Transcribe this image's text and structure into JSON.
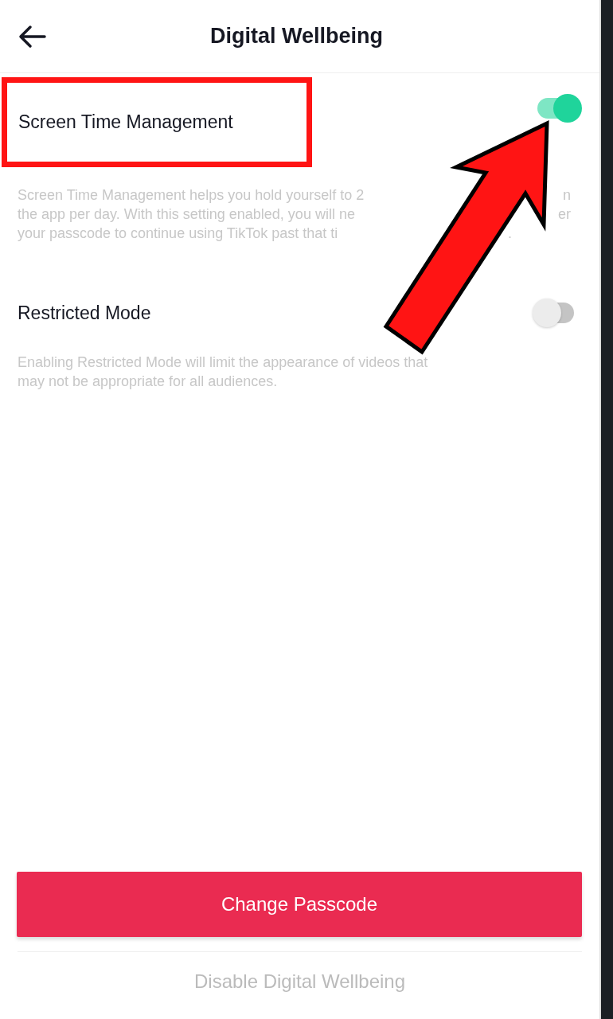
{
  "header": {
    "title": "Digital Wellbeing"
  },
  "settings": [
    {
      "label": "Screen Time Management",
      "on": true,
      "highlighted": true,
      "description_lines": [
        {
          "left": "Screen Time Management helps you hold yourself to 2",
          "right": "n"
        },
        {
          "left": "the app per day. With this setting enabled, you will ne",
          "right": "er"
        },
        {
          "left": "your passcode to continue using TikTok past that ti",
          "right": "."
        }
      ]
    },
    {
      "label": "Restricted Mode",
      "on": false,
      "highlighted": false,
      "description_lines": [
        {
          "left": "Enabling Restricted Mode will limit the appearance of videos that"
        },
        {
          "left": "may not be appropriate for all audiences."
        }
      ]
    }
  ],
  "primary_button": "Change Passcode",
  "secondary_link": "Disable Digital Wellbeing"
}
